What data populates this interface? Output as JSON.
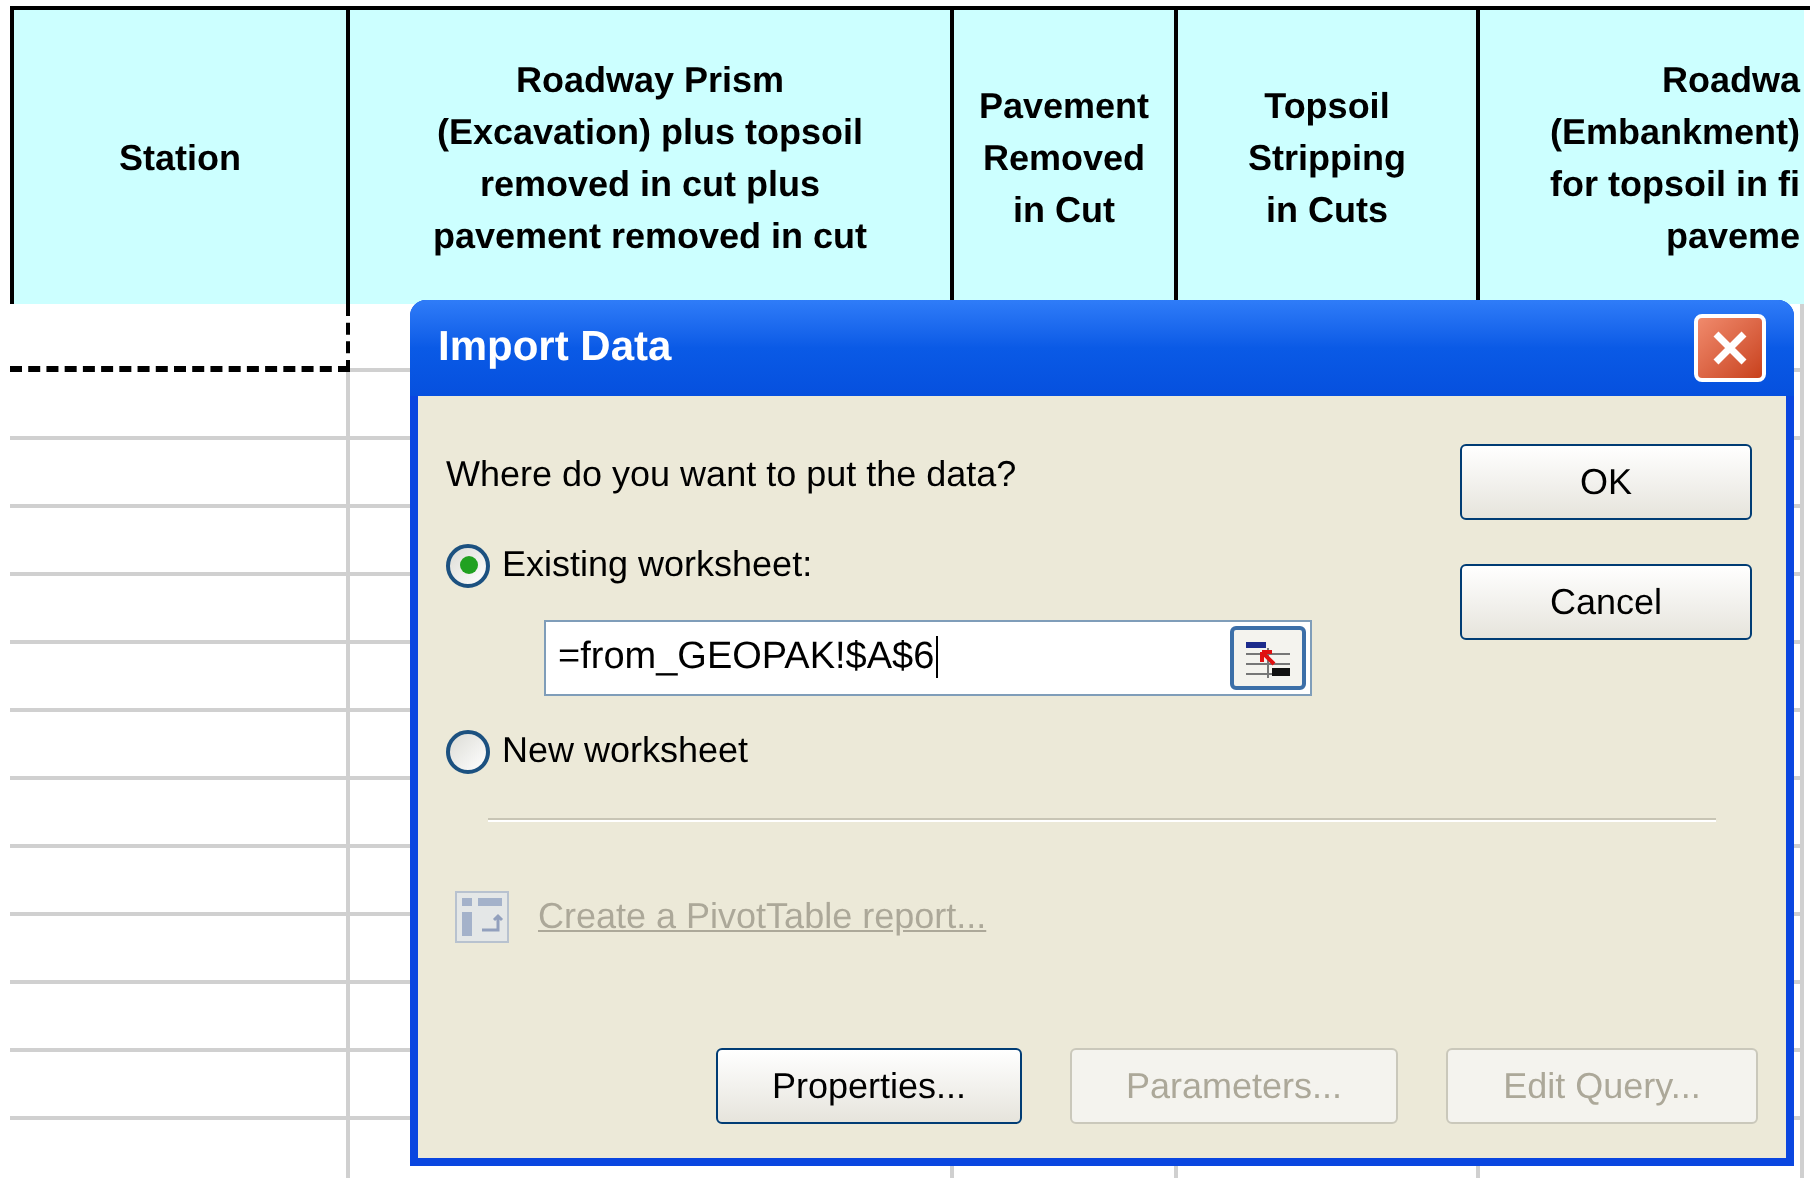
{
  "spreadsheet": {
    "columns": [
      {
        "lines": [
          "Station"
        ]
      },
      {
        "lines": [
          "Roadway Prism",
          "(Excavation) plus topsoil",
          "removed in cut plus",
          "pavement removed in cut"
        ]
      },
      {
        "lines": [
          "Pavement",
          "Removed",
          "in Cut"
        ]
      },
      {
        "lines": [
          "Topsoil",
          "Stripping",
          "in Cuts"
        ]
      },
      {
        "lines": [
          "Roadwa",
          "(Embankment)",
          "for topsoil in fi",
          "paveme"
        ]
      }
    ]
  },
  "dialog": {
    "title": "Import Data",
    "prompt": "Where do you want to put the data?",
    "options": [
      {
        "label": "Existing worksheet:",
        "selected": true
      },
      {
        "label": "New worksheet",
        "selected": false
      }
    ],
    "reference_field": {
      "value": "=from_GEOPAK!$A$6"
    },
    "pivot_link": {
      "label": "Create a PivotTable report...",
      "disabled": true
    },
    "side_buttons": [
      {
        "label": "OK",
        "disabled": false
      },
      {
        "label": "Cancel",
        "disabled": false
      }
    ],
    "bottom_buttons": [
      {
        "label": "Properties...",
        "disabled": false
      },
      {
        "label": "Parameters...",
        "disabled": true
      },
      {
        "label": "Edit Query...",
        "disabled": true
      }
    ]
  }
}
